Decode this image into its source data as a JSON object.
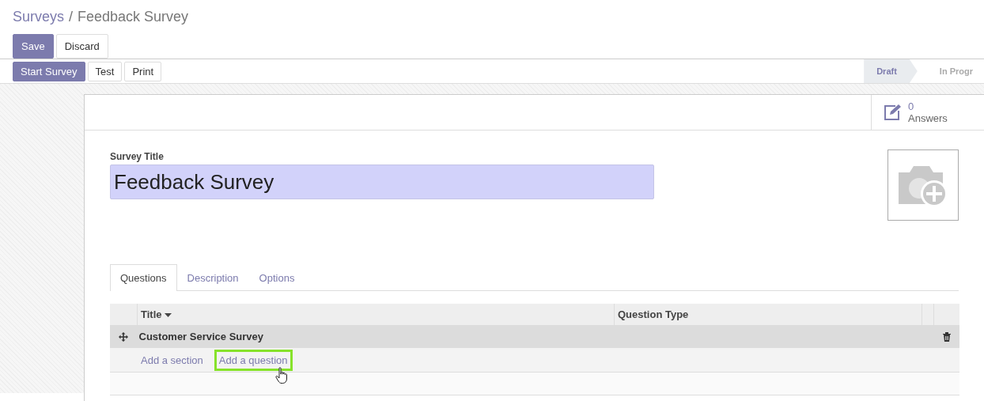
{
  "breadcrumb": {
    "parent": "Surveys",
    "separator": "/",
    "current": "Feedback Survey"
  },
  "edit_buttons": [
    {
      "label": "Save",
      "kind": "primary"
    },
    {
      "label": "Discard",
      "kind": "secondary"
    }
  ],
  "action_buttons": [
    {
      "label": "Start Survey",
      "kind": "primary"
    },
    {
      "label": "Test",
      "kind": "secondary"
    },
    {
      "label": "Print",
      "kind": "secondary"
    }
  ],
  "stages": [
    {
      "label": "Draft",
      "selected": true
    },
    {
      "label": "In Progr",
      "selected": false
    }
  ],
  "stat_button": {
    "value": "0",
    "label": "Answers"
  },
  "form": {
    "title_label": "Survey Title",
    "title_value": "Feedback Survey"
  },
  "tabs": [
    {
      "label": "Questions",
      "selected": true
    },
    {
      "label": "Description",
      "selected": false
    },
    {
      "label": "Options",
      "selected": false
    }
  ],
  "table": {
    "columns": [
      {
        "label": "Title",
        "sorted": true
      },
      {
        "label": "Question Type",
        "sorted": false
      }
    ],
    "rows": [
      {
        "title": "Customer Service Survey",
        "kind": "section"
      }
    ],
    "add_links": [
      {
        "label": "Add a section",
        "highlighted": false
      },
      {
        "label": "Add a question",
        "highlighted": true
      }
    ]
  }
}
